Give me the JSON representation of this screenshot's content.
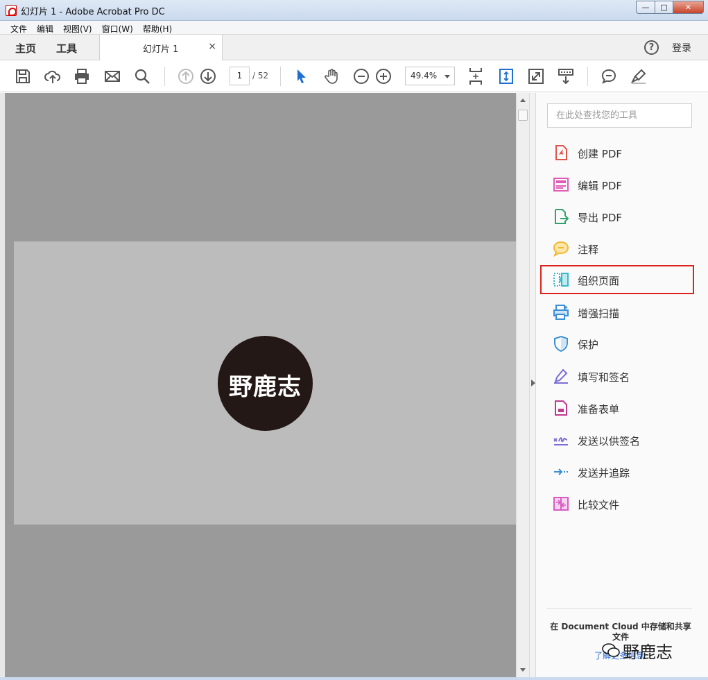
{
  "window": {
    "title": "幻灯片 1 - Adobe Acrobat Pro DC",
    "minimize_glyph": "—",
    "maximize_glyph": "□",
    "close_glyph": "✕"
  },
  "menu": [
    "文件",
    "编辑",
    "视图(V)",
    "窗口(W)",
    "帮助(H)"
  ],
  "tabs": {
    "home": "主页",
    "tools": "工具",
    "document": "幻灯片 1",
    "close_glyph": "×",
    "help_glyph": "?",
    "login": "登录"
  },
  "toolbar": {
    "icons": [
      "save-icon",
      "upload-cloud-icon",
      "print-icon",
      "email-icon",
      "search-icon",
      "page-up-icon",
      "page-down-icon",
      "select-arrow-icon",
      "hand-icon",
      "zoom-out-icon",
      "zoom-in-icon",
      "fit-page-icon",
      "scroll-mode-icon",
      "full-screen-icon",
      "read-mode-icon",
      "comment-icon",
      "highlight-icon"
    ],
    "page_current": "1",
    "page_total": "/ 52",
    "zoom": "49.4%"
  },
  "document": {
    "logo_text": "野鹿志"
  },
  "tools_pane": {
    "search_placeholder": "在此处查找您的工具",
    "items": [
      {
        "label": "创建 PDF",
        "icon": "create-pdf-icon",
        "color": "#e0554a"
      },
      {
        "label": "编辑 PDF",
        "icon": "edit-pdf-icon",
        "color": "#e05bb6"
      },
      {
        "label": "导出 PDF",
        "icon": "export-pdf-icon",
        "color": "#2fa36b"
      },
      {
        "label": "注释",
        "icon": "comment-icon",
        "color": "#f2b632"
      },
      {
        "label": "组织页面",
        "icon": "organize-pages-icon",
        "color": "#3ab7c7",
        "selected": true
      },
      {
        "label": "增强扫描",
        "icon": "enhance-scan-icon",
        "color": "#3a8fd6"
      },
      {
        "label": "保护",
        "icon": "protect-shield-icon",
        "color": "#3a8fd6"
      },
      {
        "label": "填写和签名",
        "icon": "fill-sign-icon",
        "color": "#7b6fd6"
      },
      {
        "label": "准备表单",
        "icon": "prepare-form-icon",
        "color": "#c0398f"
      },
      {
        "label": "发送以供签名",
        "icon": "send-for-signature-icon",
        "color": "#7b6fd6"
      },
      {
        "label": "发送并追踪",
        "icon": "send-track-icon",
        "color": "#3a8fd6"
      },
      {
        "label": "比较文件",
        "icon": "compare-files-icon",
        "color": "#d65bc4"
      }
    ],
    "cloud_text": "在 Document Cloud 中存储和共享文件",
    "learn_more": "了解更多信息"
  },
  "watermark": "野鹿志",
  "colors": {
    "accent_blue": "#2d6fd8",
    "selected_border": "#d9251d",
    "doc_bg": "#9a9a9a",
    "page_bg": "#bcbcbc",
    "logo_bg": "#231815"
  }
}
